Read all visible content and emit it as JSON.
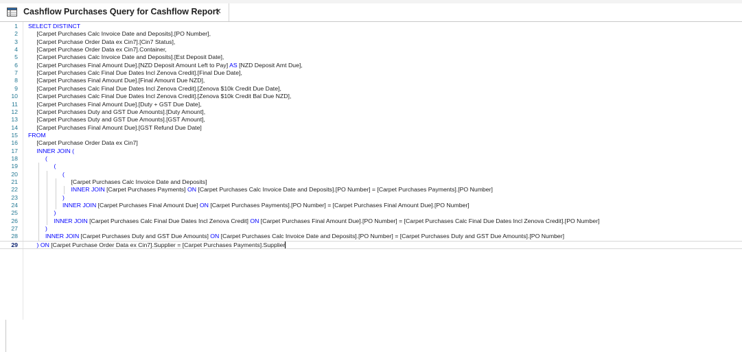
{
  "tab": {
    "title": "Cashflow Purchases Query for Cashflow Report",
    "close_glyph": "×",
    "icon": "query-table-icon"
  },
  "editor": {
    "active_line": 29,
    "lines": [
      {
        "n": "1",
        "indent": 0,
        "parts": [
          {
            "t": "SELECT DISTINCT",
            "k": true
          }
        ]
      },
      {
        "n": "2",
        "indent": 1,
        "parts": [
          {
            "t": "[Carpet Purchases Calc Invoice Date and Deposits].[PO Number],"
          }
        ]
      },
      {
        "n": "3",
        "indent": 1,
        "parts": [
          {
            "t": "[Carpet Purchase Order Data ex Cin7].[Cin7 Status],"
          }
        ]
      },
      {
        "n": "4",
        "indent": 1,
        "parts": [
          {
            "t": "[Carpet Purchase Order Data ex Cin7].Container,"
          }
        ]
      },
      {
        "n": "5",
        "indent": 1,
        "parts": [
          {
            "t": "[Carpet Purchases Calc Invoice Date and Deposits].[Est Deposit Date],"
          }
        ]
      },
      {
        "n": "6",
        "indent": 1,
        "parts": [
          {
            "t": "[Carpet Purchases Final Amount Due].[NZD Deposit Amount Left to Pay] "
          },
          {
            "t": "AS",
            "k": true
          },
          {
            "t": " [NZD Deposit Amt Due],"
          }
        ]
      },
      {
        "n": "7",
        "indent": 1,
        "parts": [
          {
            "t": "[Carpet Purchases Calc Final Due Dates Incl Zenova Credit].[Final Due Date],"
          }
        ]
      },
      {
        "n": "8",
        "indent": 1,
        "parts": [
          {
            "t": "[Carpet Purchases Final Amount Due].[Final Amount Due NZD],"
          }
        ]
      },
      {
        "n": "9",
        "indent": 1,
        "parts": [
          {
            "t": "[Carpet Purchases Calc Final Due Dates Incl Zenova Credit].[Zenova $10k Credit Due Date],"
          }
        ]
      },
      {
        "n": "10",
        "indent": 1,
        "parts": [
          {
            "t": "[Carpet Purchases Calc Final Due Dates Incl Zenova Credit].[Zenova $10k Credit Bal Due NZD],"
          }
        ]
      },
      {
        "n": "11",
        "indent": 1,
        "parts": [
          {
            "t": "[Carpet Purchases Final Amount Due].[Duty + GST Due Date],"
          }
        ]
      },
      {
        "n": "12",
        "indent": 1,
        "parts": [
          {
            "t": "[Carpet Purchases Duty and GST Due Amounts].[Duty Amount],"
          }
        ]
      },
      {
        "n": "13",
        "indent": 1,
        "parts": [
          {
            "t": "[Carpet Purchases Duty and GST Due Amounts].[GST Amount],"
          }
        ]
      },
      {
        "n": "14",
        "indent": 1,
        "parts": [
          {
            "t": "[Carpet Purchases Final Amount Due].[GST Refund Due Date]"
          }
        ]
      },
      {
        "n": "15",
        "indent": 0,
        "parts": [
          {
            "t": "FROM",
            "k": true
          }
        ]
      },
      {
        "n": "16",
        "indent": 1,
        "parts": [
          {
            "t": "[Carpet Purchase Order Data ex Cin7]"
          }
        ]
      },
      {
        "n": "17",
        "indent": 1,
        "parts": [
          {
            "t": "INNER JOIN (",
            "k": true
          }
        ]
      },
      {
        "n": "18",
        "indent": 2,
        "parts": [
          {
            "t": "(",
            "k": true
          }
        ]
      },
      {
        "n": "19",
        "indent": 3,
        "parts": [
          {
            "t": "(",
            "k": true
          }
        ]
      },
      {
        "n": "20",
        "indent": 4,
        "parts": [
          {
            "t": "(",
            "k": true
          }
        ]
      },
      {
        "n": "21",
        "indent": 5,
        "parts": [
          {
            "t": "[Carpet Purchases Calc Invoice Date and Deposits]"
          }
        ]
      },
      {
        "n": "22",
        "indent": 5,
        "parts": [
          {
            "t": "INNER JOIN",
            "k": true
          },
          {
            "t": " [Carpet Purchases Payments] "
          },
          {
            "t": "ON",
            "k": true
          },
          {
            "t": " [Carpet Purchases Calc Invoice Date and Deposits].[PO Number] = [Carpet Purchases Payments].[PO Number]"
          }
        ]
      },
      {
        "n": "23",
        "indent": 4,
        "parts": [
          {
            "t": ")",
            "k": true
          }
        ]
      },
      {
        "n": "24",
        "indent": 4,
        "parts": [
          {
            "t": "INNER JOIN",
            "k": true
          },
          {
            "t": " [Carpet Purchases Final Amount Due] "
          },
          {
            "t": "ON",
            "k": true
          },
          {
            "t": " [Carpet Purchases Payments].[PO Number] = [Carpet Purchases Final Amount Due].[PO Number]"
          }
        ]
      },
      {
        "n": "25",
        "indent": 3,
        "parts": [
          {
            "t": ")",
            "k": true
          }
        ]
      },
      {
        "n": "26",
        "indent": 3,
        "parts": [
          {
            "t": "INNER JOIN",
            "k": true
          },
          {
            "t": " [Carpet Purchases Calc Final Due Dates Incl Zenova Credit] "
          },
          {
            "t": "ON",
            "k": true
          },
          {
            "t": " [Carpet Purchases Final Amount Due].[PO Number] = [Carpet Purchases Calc Final Due Dates Incl Zenova Credit].[PO Number]"
          }
        ]
      },
      {
        "n": "27",
        "indent": 2,
        "parts": [
          {
            "t": ")",
            "k": true
          }
        ]
      },
      {
        "n": "28",
        "indent": 2,
        "parts": [
          {
            "t": "INNER JOIN",
            "k": true
          },
          {
            "t": " [Carpet Purchases Duty and GST Due Amounts] "
          },
          {
            "t": "ON",
            "k": true
          },
          {
            "t": " [Carpet Purchases Calc Invoice Date and Deposits].[PO Number] = [Carpet Purchases Duty and GST Due Amounts].[PO Number]"
          }
        ]
      },
      {
        "n": "29",
        "indent": 1,
        "parts": [
          {
            "t": ") ",
            "k": true
          },
          {
            "t": "ON",
            "k": true
          },
          {
            "t": " [Carpet Purchase Order Data ex Cin7].Supplier = [Carpet Purchases Payments].Supplier"
          }
        ]
      }
    ]
  }
}
